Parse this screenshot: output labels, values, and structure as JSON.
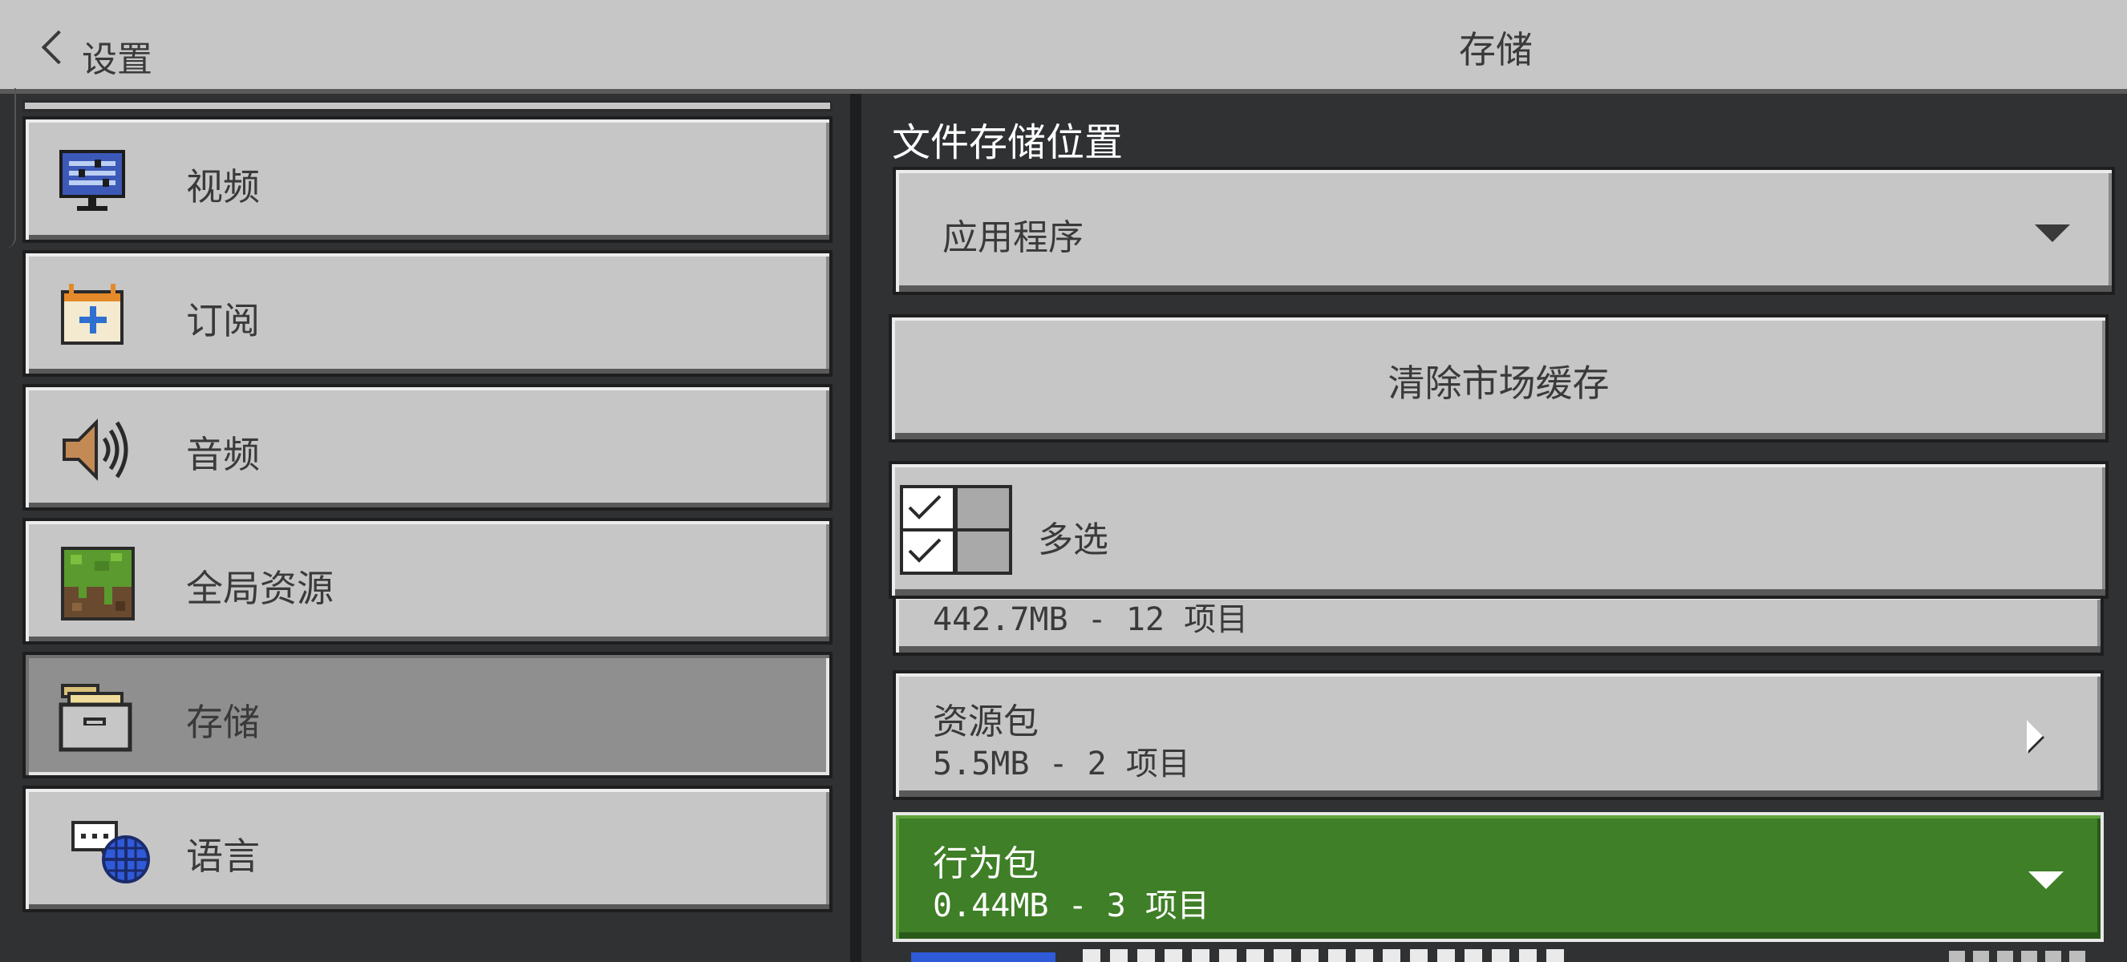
{
  "header": {
    "back_label": "设置",
    "title": "存储"
  },
  "sidebar": {
    "items": [
      {
        "label": "视频",
        "icon": "monitor-icon"
      },
      {
        "label": "订阅",
        "icon": "calendar-icon"
      },
      {
        "label": "音频",
        "icon": "speaker-icon"
      },
      {
        "label": "全局资源",
        "icon": "grass-block-icon"
      },
      {
        "label": "存储",
        "icon": "storage-box-icon",
        "selected": true
      },
      {
        "label": "语言",
        "icon": "language-globe-icon"
      }
    ]
  },
  "main": {
    "section_title": "文件存储位置",
    "storage_location": {
      "selected": "应用程序"
    },
    "clear_cache_label": "清除市场缓存",
    "multiselect_label": "多选",
    "partial_item_size": "442.7MB - 12 项目",
    "items": [
      {
        "name": "资源包",
        "size": "5.5MB - 2 项目",
        "expanded": false
      },
      {
        "name": "行为包",
        "size": "0.44MB - 3 项目",
        "expanded": true
      }
    ]
  },
  "colors": {
    "panel_bg": "#2f3133",
    "button_gray": "#c6c6c6",
    "selected_gray": "#8f8f8f",
    "accent_green": "#3f7f27"
  }
}
